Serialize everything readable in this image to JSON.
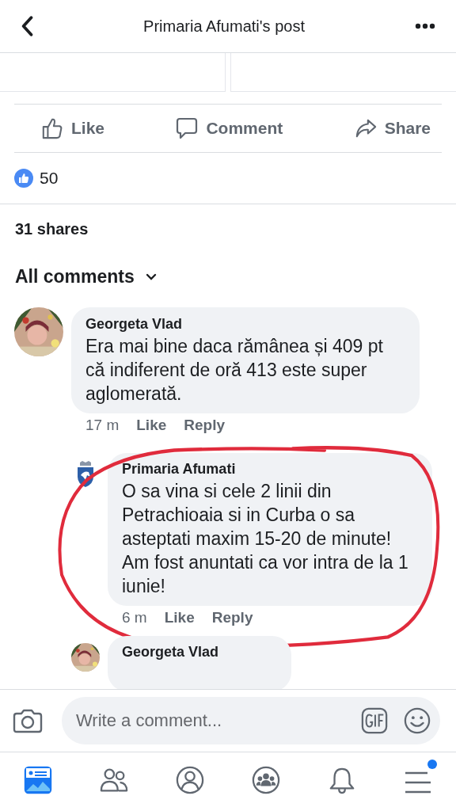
{
  "header": {
    "title": "Primaria Afumati's post"
  },
  "actions": [
    {
      "kind": "like",
      "label": "Like"
    },
    {
      "kind": "comment",
      "label": "Comment"
    },
    {
      "kind": "share",
      "label": "Share"
    }
  ],
  "reactions": {
    "count": "50"
  },
  "shares": "31 shares",
  "comments_filter": {
    "label": "All comments"
  },
  "comments": [
    {
      "author": "Georgeta Vlad",
      "text": "Era mai bine daca rămânea și 409 pt că indiferent de oră 413 este super aglomerată.",
      "time": "17 m",
      "like": "Like",
      "reply": "Reply",
      "replies": [
        {
          "kind": "crest",
          "author": "Primaria Afumati",
          "text": "O sa vina si cele 2 linii din Petrachioaia si in Curba o sa asteptati maxim 15-20 de minute! Am fost anuntati ca vor intra de la 1 iunie!",
          "time": "6 m",
          "like": "Like",
          "reply": "Reply",
          "annotated": true
        },
        {
          "author": "Georgeta Vlad"
        }
      ]
    }
  ],
  "composer": {
    "placeholder": "Write a comment..."
  },
  "nav": [
    {
      "kind": "feed",
      "selected": true
    },
    {
      "kind": "friends",
      "selected": false
    },
    {
      "kind": "profile",
      "selected": false
    },
    {
      "kind": "groups",
      "selected": false
    },
    {
      "kind": "notifications",
      "selected": false
    },
    {
      "kind": "menu",
      "selected": false,
      "badge": true
    }
  ]
}
